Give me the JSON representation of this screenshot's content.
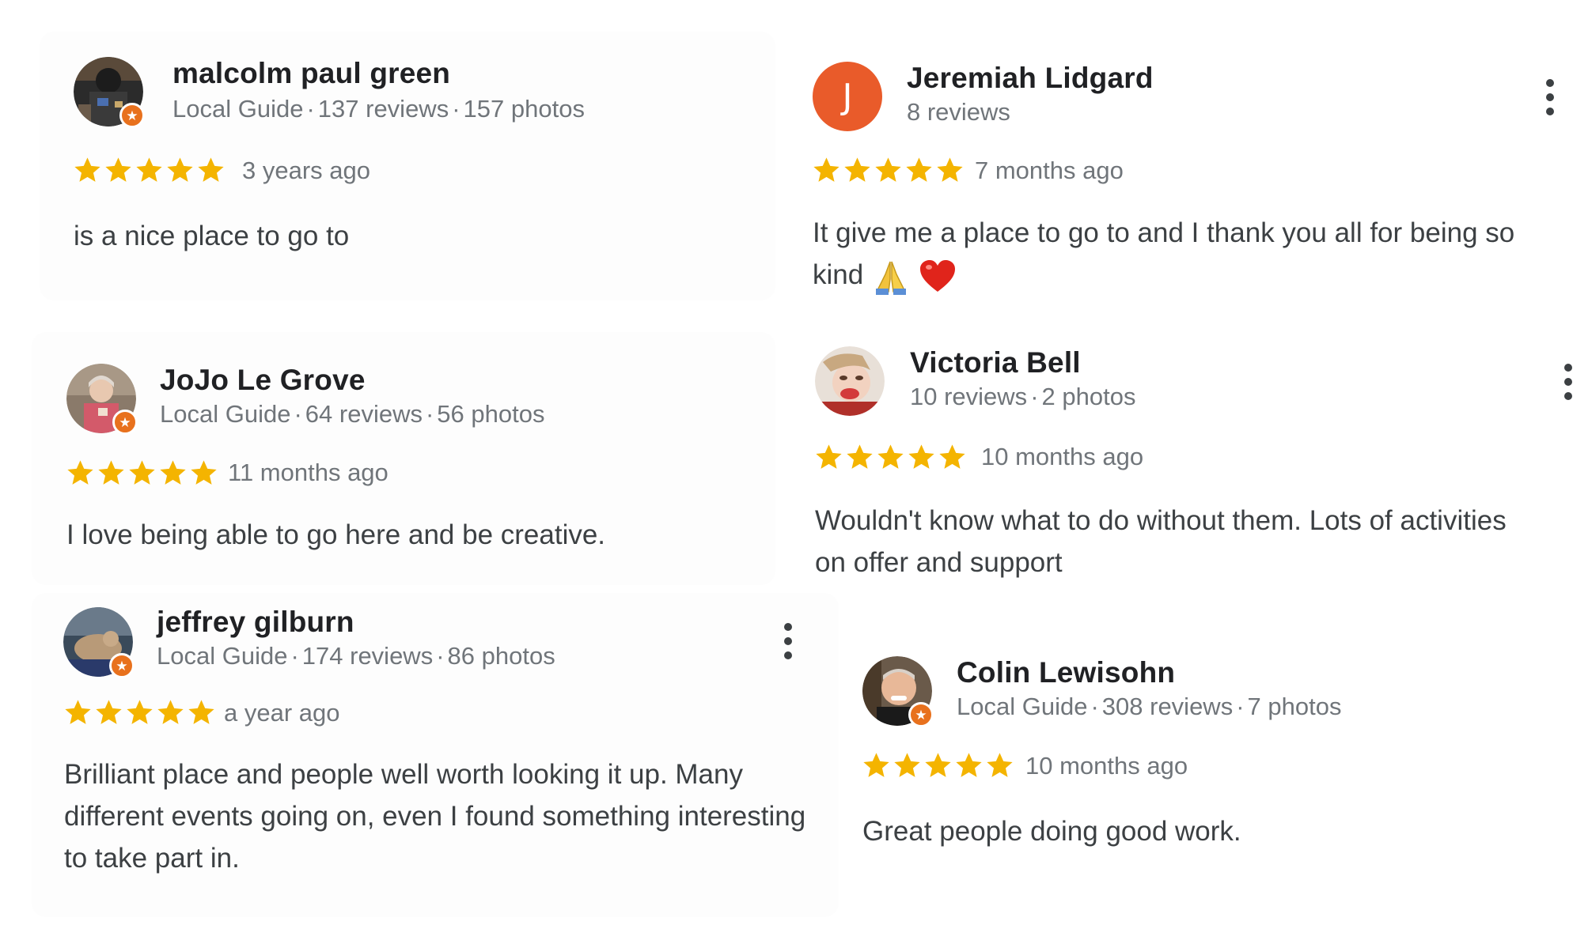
{
  "colors": {
    "star": "#f4b400",
    "guide_badge": "#e8711d",
    "letter_avatar": "#e95b2a",
    "name_text": "#202124",
    "meta_text": "#70757a",
    "body_text": "#3c4043"
  },
  "reviews": [
    {
      "name": "malcolm paul green",
      "local_guide": "Local Guide",
      "reviews": "137 reviews",
      "photos": "157 photos",
      "rating": 5,
      "date": "3 years ago",
      "text": "is a nice place to go to"
    },
    {
      "name": "Jeremiah Lidgard",
      "avatar_letter": "J",
      "reviews": "8 reviews",
      "rating": 5,
      "date": "7 months ago",
      "text": "It give me a place to go to and I thank you all for being so kind"
    },
    {
      "name": "JoJo Le Grove",
      "local_guide": "Local Guide",
      "reviews": "64 reviews",
      "photos": "56 photos",
      "rating": 5,
      "date": "11 months ago",
      "text": "I love being able to go here and be creative."
    },
    {
      "name": "Victoria Bell",
      "reviews": "10 reviews",
      "photos": "2 photos",
      "rating": 5,
      "date": "10 months ago",
      "text": "Wouldn't know what to do without them. Lots of activities on offer and support"
    },
    {
      "name": "jeffrey gilburn",
      "local_guide": "Local Guide",
      "reviews": "174 reviews",
      "photos": "86 photos",
      "rating": 5,
      "date": "a year ago",
      "text": "Brilliant place and people well worth looking it up. Many different events going on, even I found something interesting to take part in."
    },
    {
      "name": "Colin Lewisohn",
      "local_guide": "Local Guide",
      "reviews": "308 reviews",
      "photos": "7 photos",
      "rating": 5,
      "date": "10 months ago",
      "text": "Great people doing good work."
    }
  ],
  "dot_separator": "·",
  "icons": {
    "guide_badge": "star-badge-icon",
    "more": "more-vert-icon",
    "star": "star-icon",
    "emoji_1": "folded-hands-emoji",
    "emoji_2": "red-heart-emoji"
  }
}
